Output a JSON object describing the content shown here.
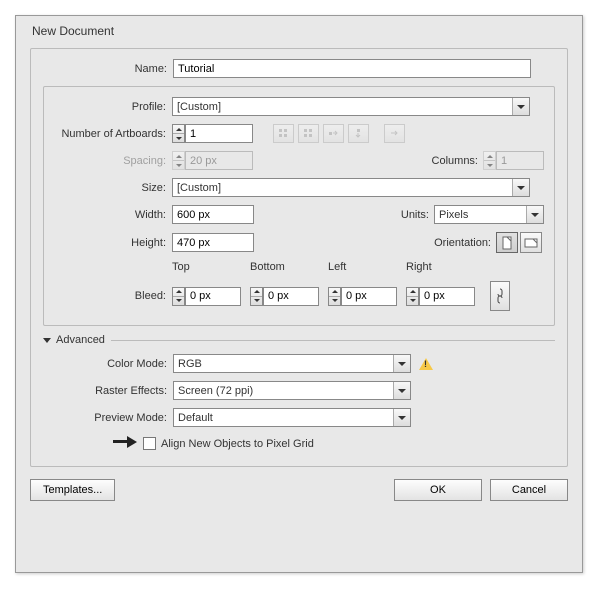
{
  "dialog_title": "New Document",
  "labels": {
    "name": "Name:",
    "profile": "Profile:",
    "artboards": "Number of Artboards:",
    "spacing": "Spacing:",
    "columns": "Columns:",
    "size": "Size:",
    "width": "Width:",
    "height": "Height:",
    "units": "Units:",
    "orientation": "Orientation:",
    "bleed": "Bleed:",
    "top": "Top",
    "bottom": "Bottom",
    "left": "Left",
    "right": "Right",
    "advanced": "Advanced",
    "color_mode": "Color Mode:",
    "raster": "Raster Effects:",
    "preview": "Preview Mode:",
    "align": "Align New Objects to Pixel Grid"
  },
  "values": {
    "name": "Tutorial",
    "profile": "[Custom]",
    "artboards": "1",
    "spacing": "20 px",
    "columns": "1",
    "size": "[Custom]",
    "width": "600 px",
    "height": "470 px",
    "units": "Pixels",
    "bleed_top": "0 px",
    "bleed_bottom": "0 px",
    "bleed_left": "0 px",
    "bleed_right": "0 px",
    "color_mode": "RGB",
    "raster": "Screen (72 ppi)",
    "preview": "Default",
    "align_checked": false
  },
  "buttons": {
    "templates": "Templates...",
    "ok": "OK",
    "cancel": "Cancel"
  }
}
